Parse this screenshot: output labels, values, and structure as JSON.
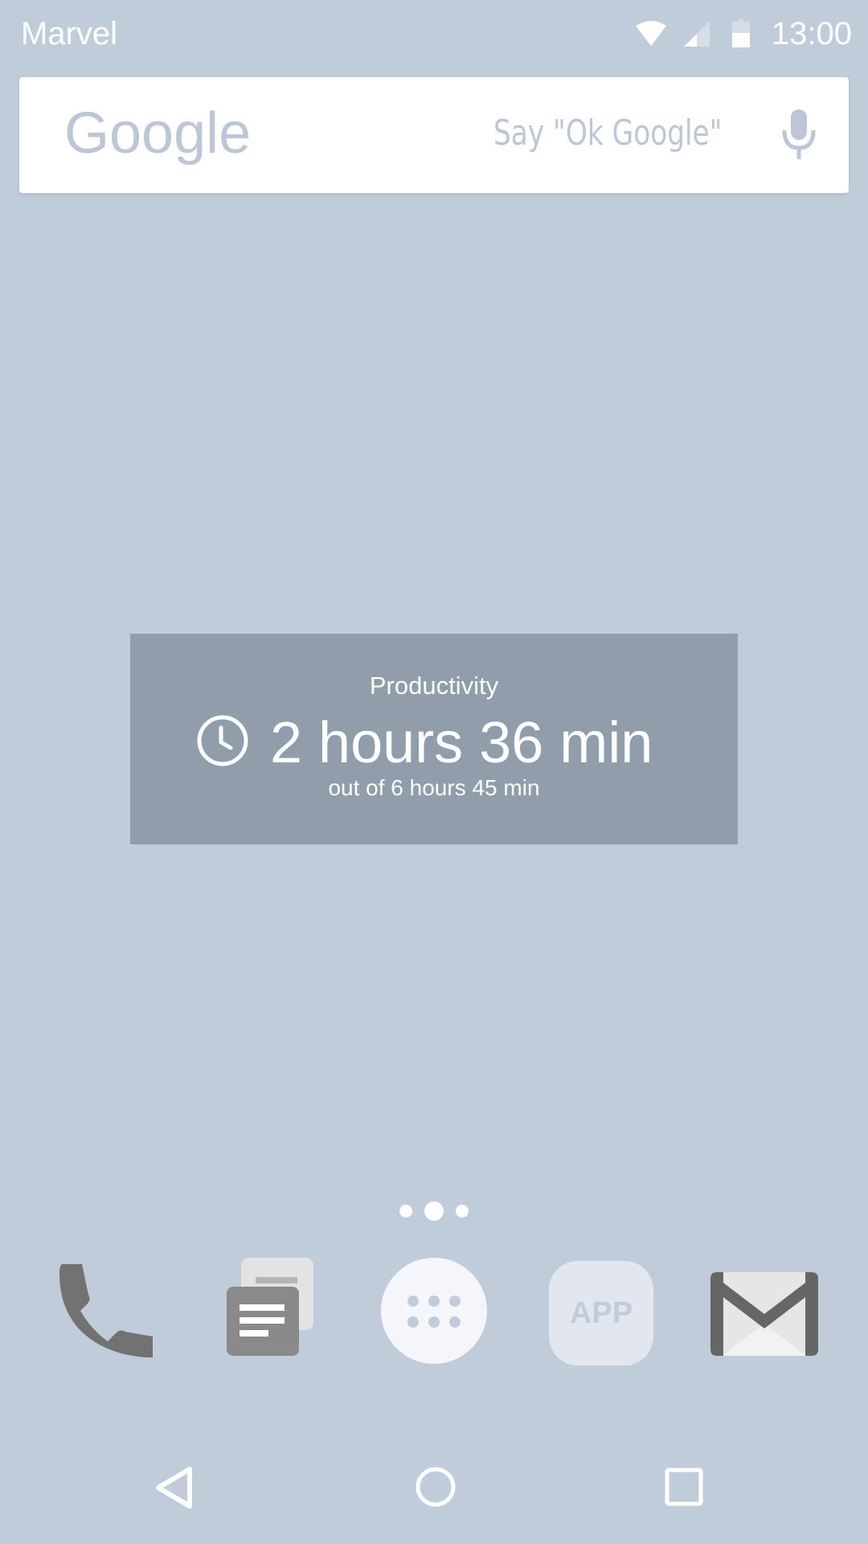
{
  "status_bar": {
    "carrier": "Marvel",
    "time": "13:00",
    "icons": [
      "wifi-icon",
      "cell-signal-icon",
      "battery-icon"
    ]
  },
  "search": {
    "brand": "Google",
    "hint": "Say \"Ok Google\"",
    "icon": "microphone-icon"
  },
  "widget": {
    "title": "Productivity",
    "value": "2 hours 36 min",
    "subtitle": "out of 6 hours 45 min",
    "icon": "clock-icon"
  },
  "pager": {
    "pages": 3,
    "current": 2
  },
  "dock": {
    "items": [
      {
        "name": "phone",
        "icon": "phone-icon"
      },
      {
        "name": "notes",
        "icon": "notes-icon"
      },
      {
        "name": "app-drawer",
        "icon": "apps-grid-icon"
      },
      {
        "name": "app",
        "label": "APP"
      },
      {
        "name": "mail",
        "icon": "mail-icon"
      }
    ]
  },
  "nav": {
    "buttons": [
      "back-icon",
      "home-icon",
      "recents-icon"
    ]
  },
  "colors": {
    "wallpaper": "#c1ccdb",
    "widget_background": "#919daa",
    "search_hint": "#bcc6d6",
    "dock_icon": "#777777"
  }
}
